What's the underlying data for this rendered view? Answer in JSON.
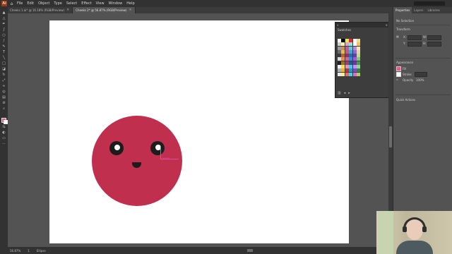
{
  "app": {
    "logo_text": "Ai",
    "menu": [
      "File",
      "Edit",
      "Object",
      "Type",
      "Select",
      "Effect",
      "View",
      "Window",
      "Help"
    ]
  },
  "tabs": [
    {
      "label": "Cheeks 1.ai* @ 16.18% (RGB/Preview)",
      "active": false
    },
    {
      "label": "Cheeks 2* @ 56.87% (RGB/Preview)",
      "active": true
    }
  ],
  "tab_close": "×",
  "toolbar_icons": [
    "selection-tool",
    "direct-selection-tool",
    "pen-tool",
    "curvature-tool",
    "ellipse-tool",
    "paintbrush-tool",
    "pencil-tool",
    "type-tool",
    "line-tool",
    "rectangle-tool",
    "eraser-tool",
    "rotate-tool",
    "scale-tool",
    "width-tool",
    "shape-builder-tool",
    "gradient-tool",
    "eyedropper-tool",
    "blend-tool",
    "symbol-sprayer-tool",
    "column-graph-tool",
    "artboard-tool",
    "slice-tool",
    "hand-tool",
    "zoom-tool"
  ],
  "fill_color": "#e85a86",
  "face": {
    "color": "#c0304e",
    "eye_color": "#1c1c1c",
    "highlight_color": "#ffffff"
  },
  "selection_label": "anchor",
  "swatches_panel": {
    "title": "Swatches",
    "colors": [
      [
        "#ffffff",
        "#000000",
        "#e8e84a",
        "#d62e2e",
        "#f4f4f4",
        "#f7d88a"
      ],
      [
        "#cfcfcf",
        "#f7f7a0",
        "#e8a0c8",
        "#9adbe0",
        "#ffffff",
        "#f5c05a"
      ],
      [
        "#9a9a9a",
        "#d98a4f",
        "#c55a9c",
        "#6bc3d6",
        "#b88bd1",
        "#f2e7b0"
      ],
      [
        "#6a6a6a",
        "#e0c040",
        "#d8507a",
        "#4aa3c8",
        "#8a6fc9",
        "#e6d6a0"
      ],
      [
        "#3a3a3a",
        "#c85a3a",
        "#9a2f5a",
        "#2f6aa8",
        "#5e46a0",
        "#bfe07a"
      ],
      [
        "#d8d8d8",
        "#f28a3a",
        "#e05a9a",
        "#3a8ad0",
        "#a35ad8",
        "#7ad05a"
      ],
      [
        "#222222",
        "#a8701e",
        "#b03a5a",
        "#1e5a8a",
        "#6a3a98",
        "#3aa04a"
      ],
      [
        "#f0f0f0",
        "#f5e05a",
        "#ef90b0",
        "#5ac0e8",
        "#c890f0",
        "#8ae08a"
      ],
      [
        "#b0b0b0",
        "#f0b02a",
        "#c8302e",
        "#2a98b8",
        "#7a50c0",
        "#2e8a3a"
      ],
      [
        "#e8e8e8",
        "#fff07a",
        "#ff5a7a",
        "#4ad0d0",
        "#d070d0",
        "#a0d84a"
      ]
    ]
  },
  "right_panel": {
    "tabs": [
      "Properties",
      "Layers",
      "Libraries"
    ],
    "no_selection": "No Selection",
    "transform": "Transform",
    "x_label": "X:",
    "y_label": "Y:",
    "w_label": "W:",
    "h_label": "H:",
    "appearance": "Appearance",
    "fill_label": "Fill",
    "stroke_label": "Stroke",
    "opacity_label": "Opacity",
    "opacity_value": "100%",
    "quick_actions": "Quick Actions"
  },
  "status": {
    "zoom": "56.87%",
    "artboard": "1",
    "tool": "Ellipse"
  }
}
